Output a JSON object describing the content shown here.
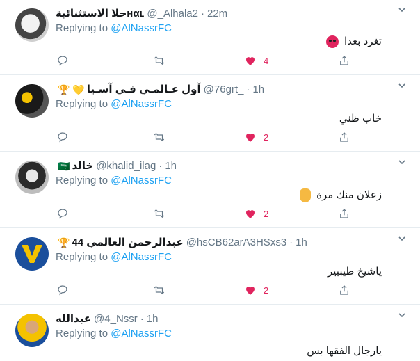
{
  "replying_prefix": "Replying to",
  "tweets": [
    {
      "name": "حلا الاستثنائية",
      "name_prefix": "ʜαʟ",
      "badge": "",
      "handle": "@_Alhala2",
      "time": "22m",
      "mention": "@AlNassrFC",
      "text": "تغرد بعدا",
      "emoji": "angry-face",
      "likes": "4",
      "liked": true
    },
    {
      "name": "آول عـالمـي فـي آسـيا",
      "badge": "🏆 💛",
      "handle": "@76grt_",
      "time": "1h",
      "mention": "@AlNassrFC",
      "text": "خاب ظني",
      "emoji": "",
      "likes": "2",
      "liked": true
    },
    {
      "name": "خالد",
      "badge": "🇸🇦",
      "handle": "@khalid_ilag",
      "time": "1h",
      "mention": "@AlNassrFC",
      "text": "زعلان منك مرة",
      "emoji": "hand",
      "likes": "2",
      "liked": true
    },
    {
      "name": "عبدالرحمن العالمي 44",
      "badge": "🏆",
      "handle": "@hsCB62arA3HSxs3",
      "time": "1h",
      "mention": "@AlNassrFC",
      "text": "ياشيخ طيبيير",
      "emoji": "",
      "likes": "2",
      "liked": true
    },
    {
      "name": "عبدالله",
      "badge": "",
      "handle": "@4_Nssr",
      "time": "1h",
      "mention": "@AlNassrFC",
      "text": "يارجال الفقها بس",
      "emoji": "",
      "likes": "",
      "liked": false
    }
  ],
  "colors": {
    "link": "#1da1f2",
    "muted": "#657786",
    "like": "#e0245e",
    "border": "#e6ecf0"
  }
}
